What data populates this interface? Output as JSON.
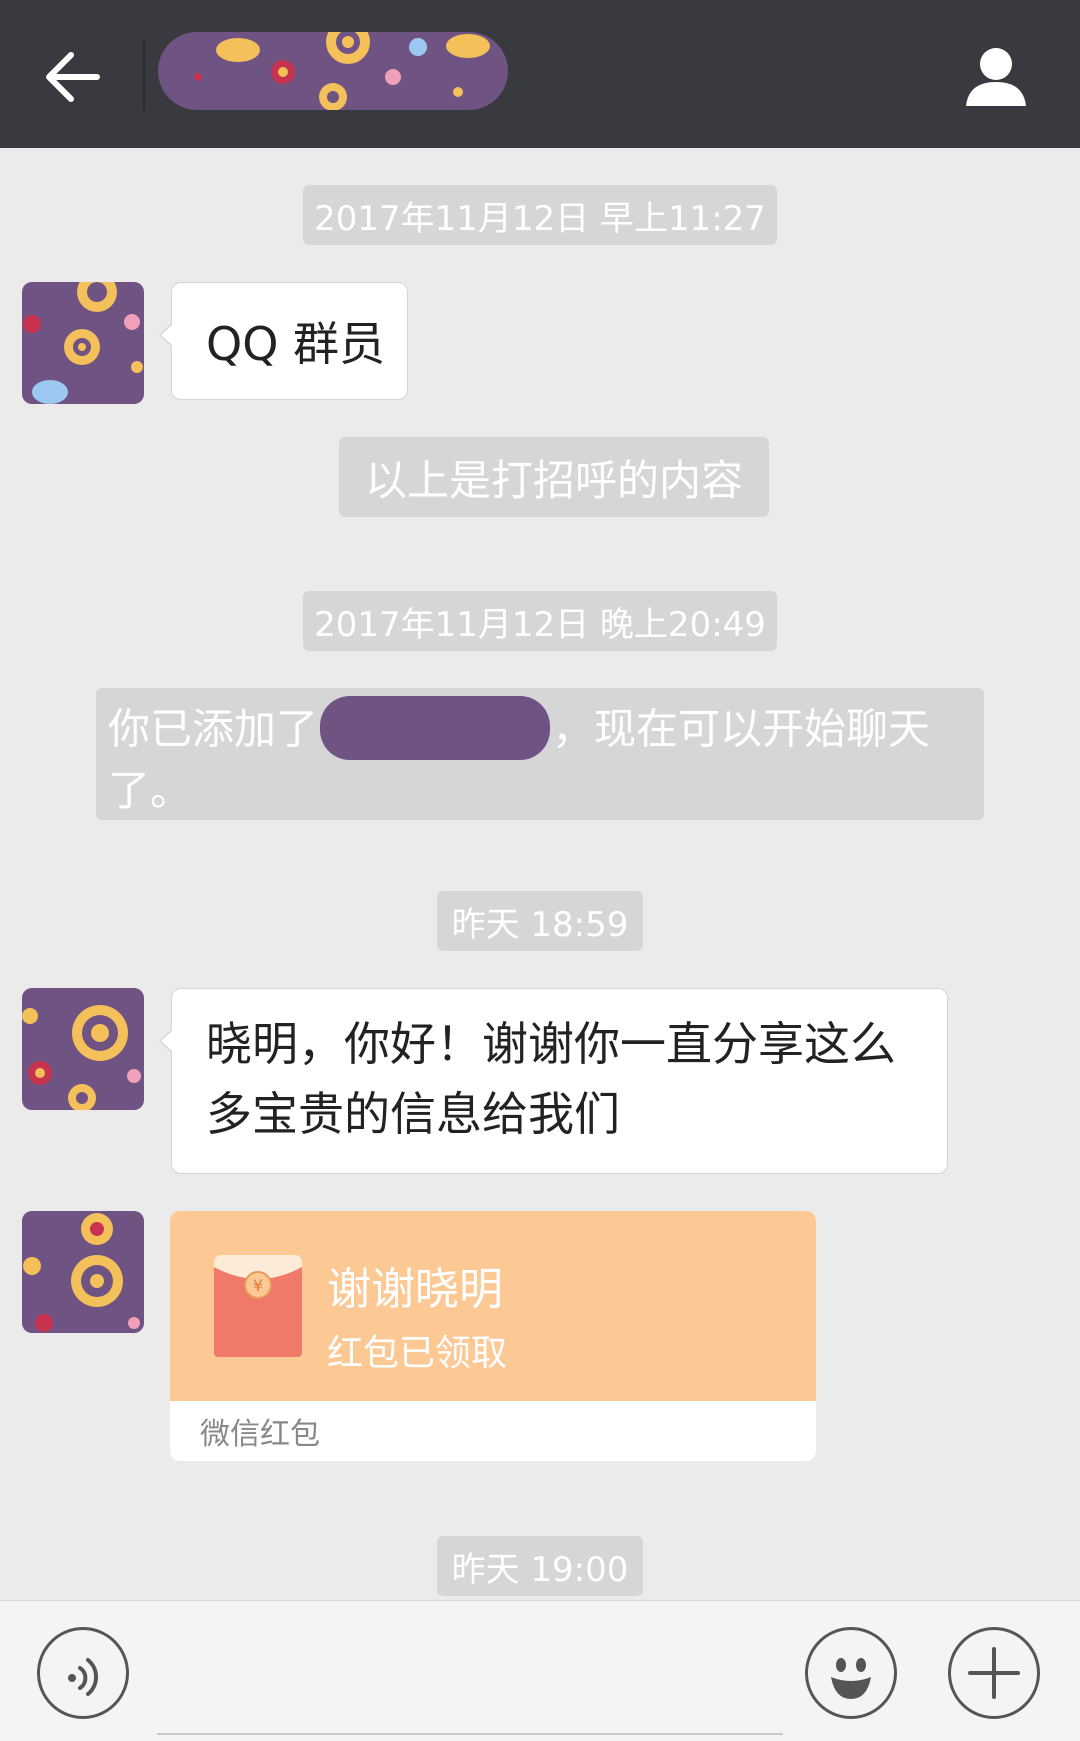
{
  "header": {
    "back_icon": "arrow-left-icon",
    "title_redacted": true,
    "profile_icon": "user-icon"
  },
  "messages": {
    "ts1": "2017年11月12日 早上11:27",
    "greeting_text": "QQ 群员",
    "sys_greeting_note": "以上是打招呼的内容",
    "ts2": "2017年11月12日 晚上20:49",
    "added_prefix": "你已添加了",
    "added_suffix": "，现在可以开始聊天了。",
    "ts3": "昨天 18:59",
    "msg_thanks": "晓明，你好！谢谢你一直分享这么多宝贵的信息给我们",
    "ts4": "昨天 19:00"
  },
  "red_packet": {
    "title": "谢谢晓明",
    "status": "红包已领取",
    "footer": "微信红包",
    "icon": "red-envelope-icon",
    "bg_color": "#fcc995"
  },
  "input_bar": {
    "voice_icon": "voice-icon",
    "emoji_icon": "smiley-icon",
    "plus_icon": "plus-icon",
    "value": ""
  },
  "colors": {
    "header_bg": "#393a3f",
    "chat_bg": "#ebebeb",
    "system_pill": "#d6d6d6",
    "redaction": "#6e5383"
  }
}
